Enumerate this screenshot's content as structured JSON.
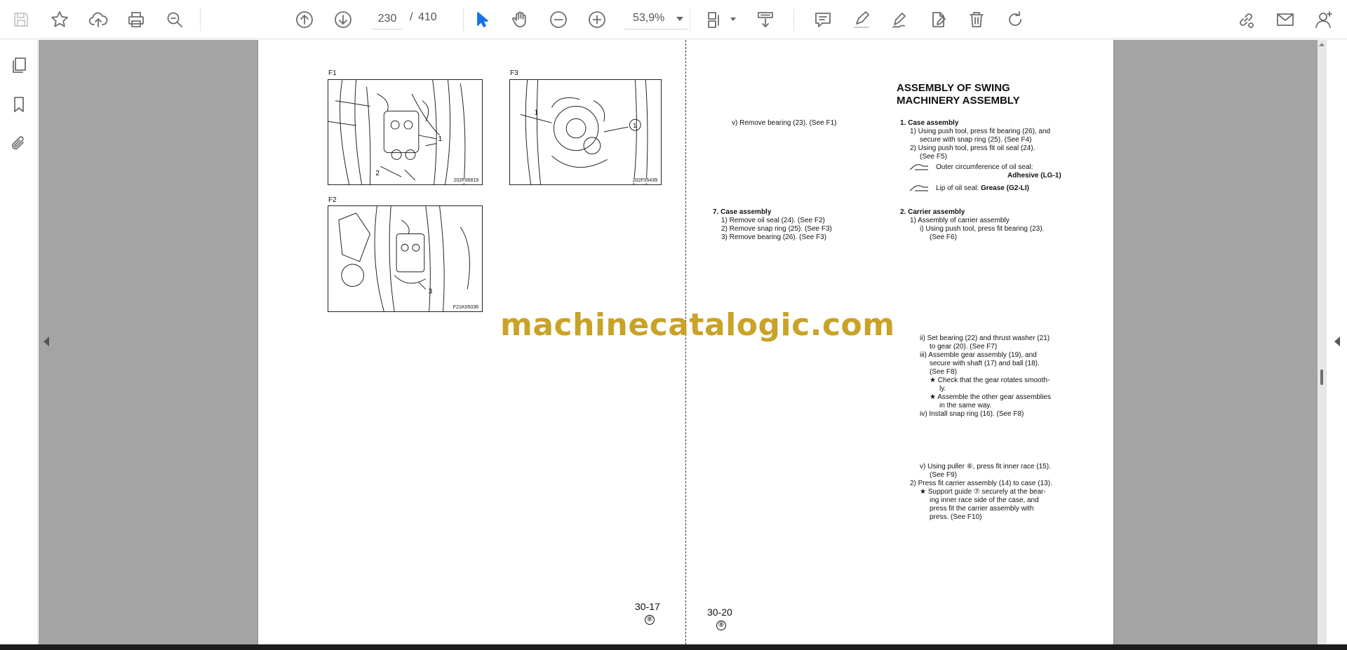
{
  "toolbar": {
    "page_current": "230",
    "page_separator": "/",
    "page_total": "410",
    "zoom": "53,9%",
    "tools": [
      "save",
      "bookmark-star",
      "upload-cloud",
      "print",
      "find",
      "page-up",
      "page-down",
      "select",
      "hand",
      "zoom-out",
      "zoom-in",
      "page-display",
      "scroll-mode",
      "comment",
      "highlight",
      "sign",
      "fill-sign",
      "delete",
      "rotate",
      "share-link",
      "email",
      "account"
    ]
  },
  "left_rail": {
    "items": [
      "page-thumbnails",
      "bookmarks",
      "attachments"
    ]
  },
  "watermark": "machinecatalogic.com",
  "left_page": {
    "fig_f1": {
      "label": "F1",
      "code": "202F06819"
    },
    "fig_f3": {
      "label": "F3",
      "code": "202F05439"
    },
    "fig_f2": {
      "label": "F2",
      "code": "F21K05036"
    },
    "page_number": "30-17",
    "revision": "⑧"
  },
  "middle": {
    "remove_bearing": "v)  Remove bearing (23). (See F1)",
    "case_heading": "7.  Case assembly",
    "step1": "1)  Remove oil seal (24). (See F2)",
    "step2": "2)  Remove snap ring (25). (See F3)",
    "step3": "3)  Remove bearing (26). (See F3)",
    "page_number": "30-20",
    "revision": "⑧"
  },
  "right": {
    "heading_line1": "ASSEMBLY OF SWING",
    "heading_line2": "MACHINERY ASSEMBLY",
    "s1_heading": "1.  Case assembly",
    "s1_a1": "1)  Using push tool, press fit bearing (26), and",
    "s1_a2": "secure with snap ring (25). (See F4)",
    "s1_b1": "2)  Using push tool, press fit oil seal (24).",
    "s1_b2": "(See F5)",
    "note1_label": "Outer circumference of oil seal:",
    "note1_value": "Adhesive (LG-1)",
    "note2_label": "Lip of oil seal: ",
    "note2_value": "Grease (G2-LI)",
    "s2_heading": "2.  Carrier assembly",
    "s2_a": "1)  Assembly of carrier assembly",
    "s2_i1": "i)  Using push tool, press fit bearing (23).",
    "s2_i2": "(See F6)",
    "s2_ii1": "ii)  Set bearing (22) and thrust washer (21)",
    "s2_ii2": "to gear (20). (See F7)",
    "s2_iii1": "iii)  Assemble  gear  assembly  (19),  and",
    "s2_iii2": "secure with shaft (17) and ball (18).",
    "s2_iii3": "(See F8)",
    "s2_star1a": "★ Check that the gear rotates smooth-",
    "s2_star1b": "ly.",
    "s2_star2a": "★ Assemble the other gear assemblies",
    "s2_star2b": "in the same way.",
    "s2_iv": "iv)  Install snap ring (16). (See F8)",
    "s2_v1": "v)  Using puller ⑥, press fit inner race (15).",
    "s2_v2": "(See F9)",
    "s2_b": "2)  Press fit carrier assembly (14) to case (13).",
    "s2_star3a": "★ Support guide ⑦ securely at the bear-",
    "s2_star3b": "ing  inner race side of the case, and",
    "s2_star3c": "press  fit  the  carrier  assembly  with",
    "s2_star3d": "press. (See F10)"
  }
}
